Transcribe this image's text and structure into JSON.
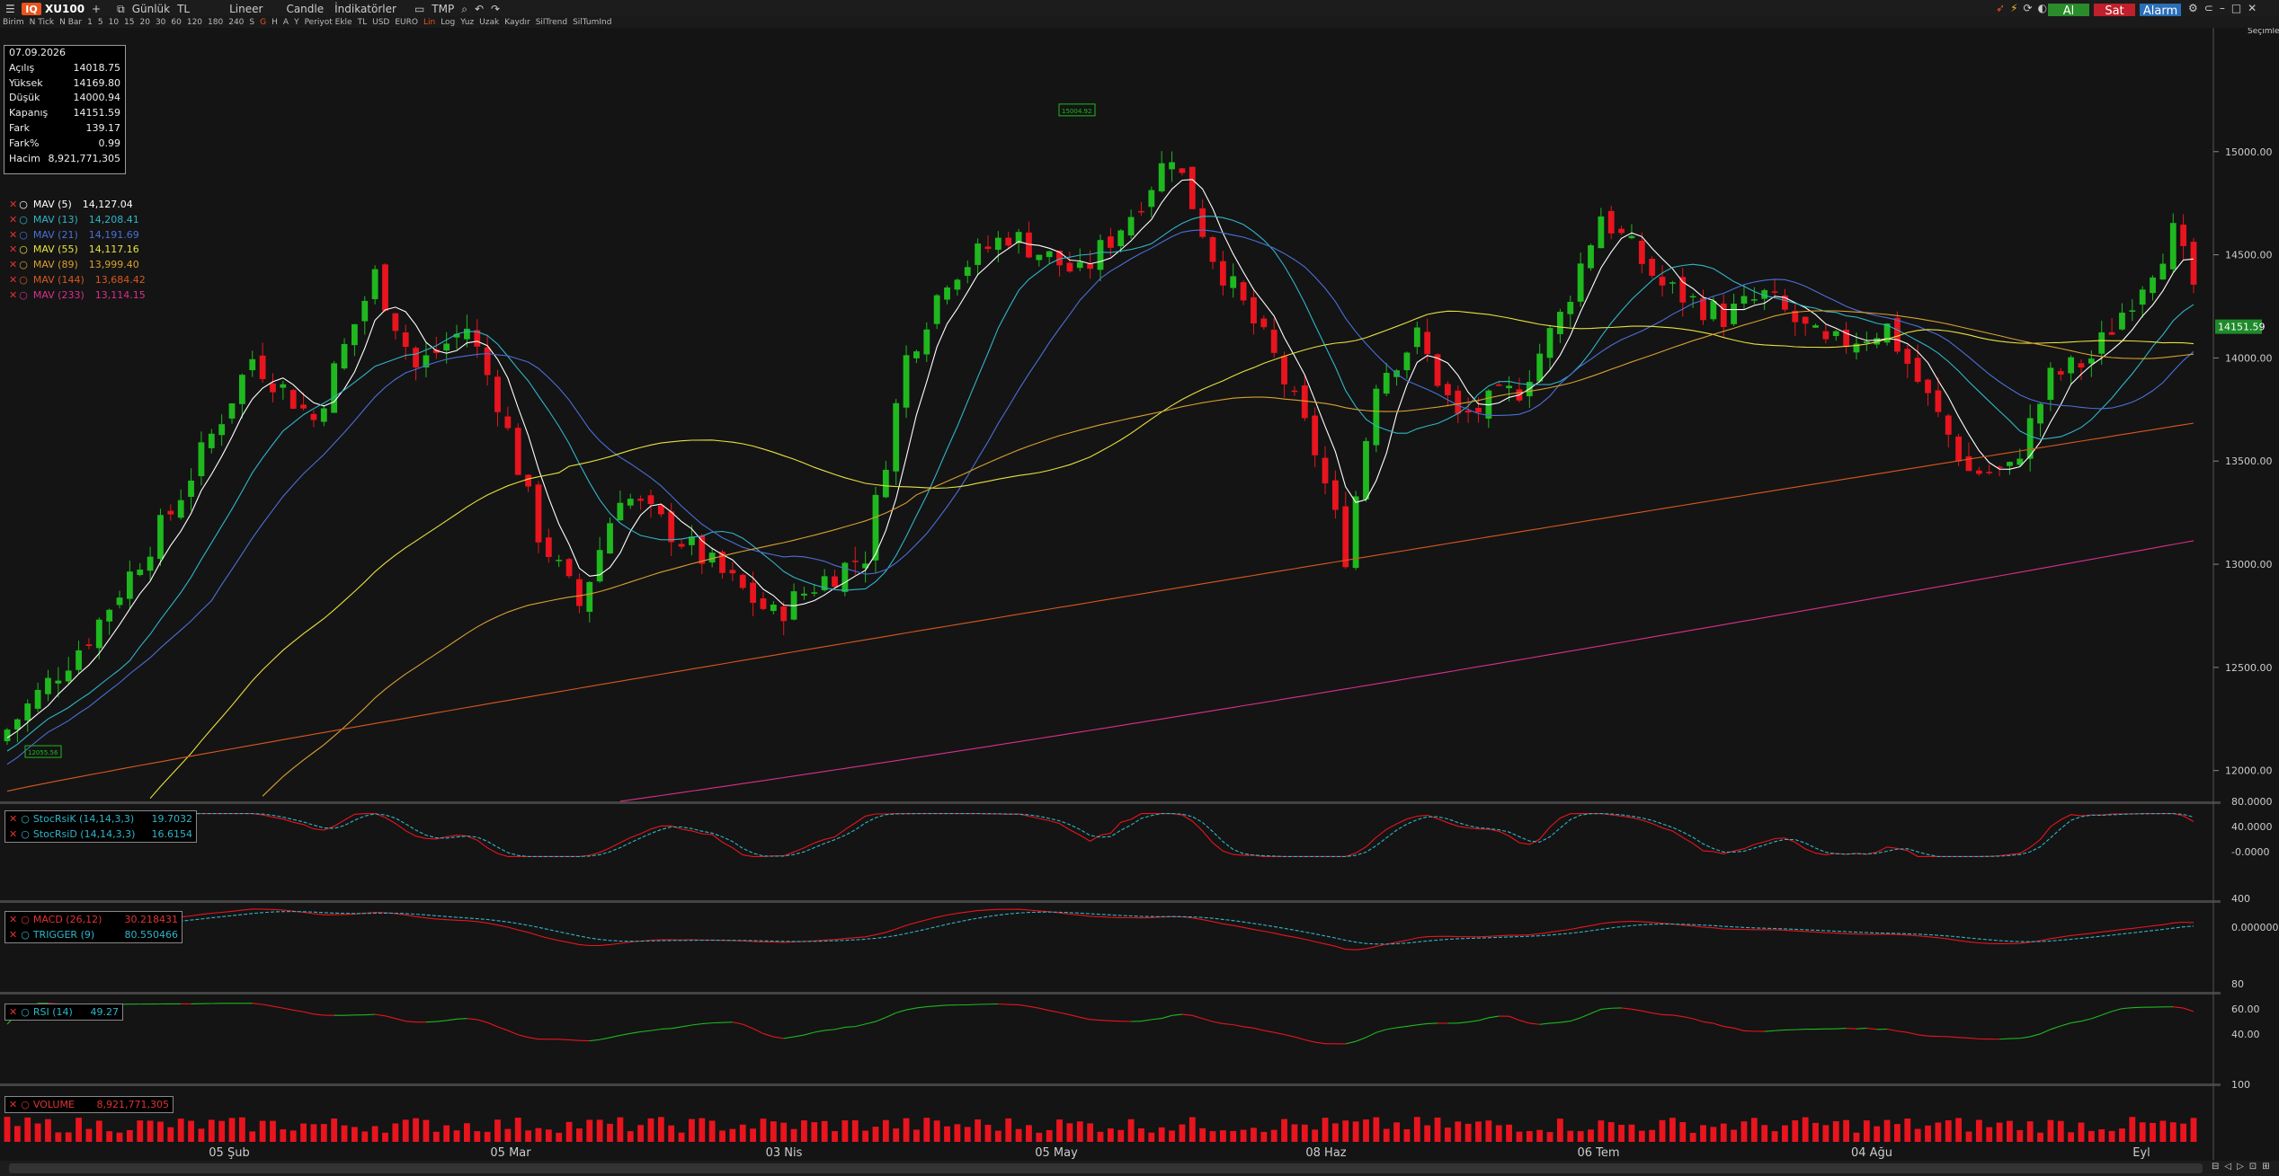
{
  "toolbar": {
    "symbol": "XU100",
    "period": "Günlük",
    "currency": "TL",
    "scale": "Lineer",
    "chart_type": "Candle",
    "indicators": "İndikatörler",
    "template": "TMP",
    "buy_label": "Al",
    "sell_label": "Sat",
    "alarm_label": "Alarm",
    "logo": "IQ",
    "secimler": "Seçimler"
  },
  "toolbar2": [
    "Birim",
    "N Tick",
    "N Bar",
    "1",
    "5",
    "10",
    "15",
    "20",
    "30",
    "60",
    "120",
    "180",
    "240",
    "S",
    "G",
    "H",
    "A",
    "Y",
    "Periyot Ekle",
    "TL",
    "USD",
    "EURO",
    "Lin",
    "Log",
    "Yuz",
    "Uzak",
    "Kaydır",
    "SilTrend",
    "SilTumInd"
  ],
  "info": {
    "date": "07.09.2026",
    "rows": [
      {
        "label": "Açılış",
        "value": "14018.75"
      },
      {
        "label": "Yüksek",
        "value": "14169.80"
      },
      {
        "label": "Düşük",
        "value": "14000.94"
      },
      {
        "label": "Kapanış",
        "value": "14151.59"
      },
      {
        "label": "Fark",
        "value": "139.17"
      },
      {
        "label": "Fark%",
        "value": "0.99"
      },
      {
        "label": "Hacim",
        "value": "8,921,771,305"
      }
    ]
  },
  "moving_averages": [
    {
      "name": "MAV (5)",
      "value": "14,127.04",
      "color": "#ffffff"
    },
    {
      "name": "MAV (13)",
      "value": "14,208.41",
      "color": "#2fb5c8"
    },
    {
      "name": "MAV (21)",
      "value": "14,191.69",
      "color": "#4a6fd8"
    },
    {
      "name": "MAV (55)",
      "value": "14,117.16",
      "color": "#e8e040"
    },
    {
      "name": "MAV (89)",
      "value": "13,999.40",
      "color": "#d8a030"
    },
    {
      "name": "MAV (144)",
      "value": "13,684.42",
      "color": "#d85820"
    },
    {
      "name": "MAV (233)",
      "value": "13,114.15",
      "color": "#d8308a"
    }
  ],
  "price_axis": {
    "ticks": [
      "15000.00",
      "14500.00",
      "14000.00",
      "13500.00",
      "13000.00",
      "12500.00",
      "12000.00"
    ],
    "last_price": "14151.59",
    "high_label": "15004.92",
    "low_label": "12055.56"
  },
  "time_axis": [
    "05 Şub",
    "05 Mar",
    "03 Nis",
    "05 May",
    "08 Haz",
    "06 Tem",
    "04 Ağu",
    "Eyl"
  ],
  "stoch": {
    "k_name": "StocRsiK (14,14,3,3)",
    "k_value": "19.7032",
    "d_name": "StocRsiD (14,14,3,3)",
    "d_value": "16.6154",
    "ticks": [
      "80.0000",
      "40.0000",
      "-0.0000"
    ]
  },
  "macd": {
    "macd_name": "MACD (26,12)",
    "macd_value": "30.218431",
    "trigger_name": "TRIGGER (9)",
    "trigger_value": "80.550466",
    "ticks": [
      "400",
      "0.000000"
    ]
  },
  "rsi": {
    "name": "RSI (14)",
    "value": "49.27",
    "ticks": [
      "80",
      "60.00",
      "40.00"
    ]
  },
  "volume": {
    "name": "VOLUME",
    "value": "8,921,771,305",
    "ticks": [
      "100"
    ]
  },
  "colors": {
    "up": "#1fb81f",
    "down": "#e8141e",
    "buy": "#2a8c2a",
    "sell": "#c0202a",
    "alarm": "#2a6fb8"
  }
}
